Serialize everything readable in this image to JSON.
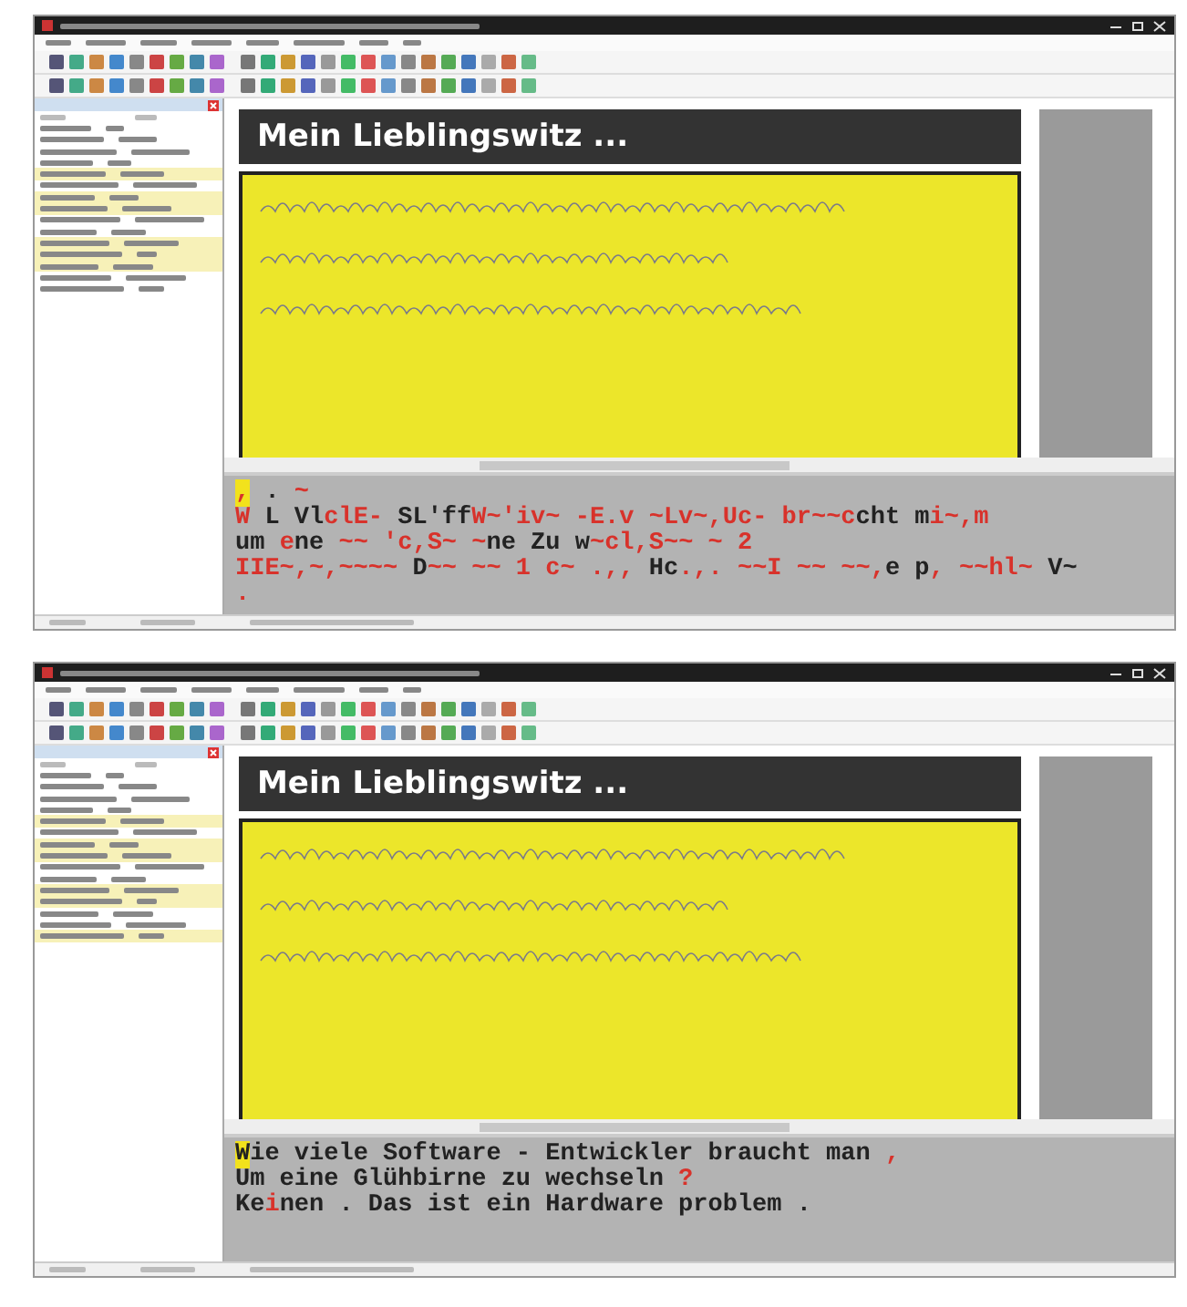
{
  "screens": [
    {
      "document_title": "Mein Lieblingswitz ...",
      "field_rows": [
        {
          "highlighted": false
        },
        {
          "highlighted": false
        },
        {
          "highlighted": false
        },
        {
          "highlighted": false
        },
        {
          "highlighted": true
        },
        {
          "highlighted": false
        },
        {
          "highlighted": true
        },
        {
          "highlighted": true
        },
        {
          "highlighted": false
        },
        {
          "highlighted": false
        },
        {
          "highlighted": true
        },
        {
          "highlighted": true
        },
        {
          "highlighted": true
        },
        {
          "highlighted": false
        },
        {
          "highlighted": false
        }
      ],
      "ocr_lines": [
        [
          {
            "text": ",",
            "uncertain": true,
            "cursor": true
          },
          {
            "text": " . ",
            "uncertain": false,
            "cursor": false
          },
          {
            "text": "~",
            "uncertain": true,
            "cursor": false
          }
        ],
        [
          {
            "text": "W",
            "uncertain": true,
            "cursor": false
          },
          {
            "text": " L Vl",
            "uncertain": false,
            "cursor": false
          },
          {
            "text": "clE-",
            "uncertain": true,
            "cursor": false
          },
          {
            "text": " SL'ff",
            "uncertain": false,
            "cursor": false
          },
          {
            "text": "W~'iv~ -E.v ~Lv~,Uc- br~~c",
            "uncertain": true,
            "cursor": false
          },
          {
            "text": "cht m",
            "uncertain": false,
            "cursor": false
          },
          {
            "text": "i~,m",
            "uncertain": true,
            "cursor": false
          }
        ],
        [
          {
            "text": "um ",
            "uncertain": false,
            "cursor": false
          },
          {
            "text": "e",
            "uncertain": true,
            "cursor": false
          },
          {
            "text": "ne",
            "uncertain": false,
            "cursor": false
          },
          {
            "text": " ~~ 'c,S~ ~",
            "uncertain": true,
            "cursor": false
          },
          {
            "text": "ne Zu w",
            "uncertain": false,
            "cursor": false
          },
          {
            "text": "~cl,S~~ ~ 2",
            "uncertain": true,
            "cursor": false
          }
        ],
        [
          {
            "text": "IIE~,~,~~~~",
            "uncertain": true,
            "cursor": false
          },
          {
            "text": " D",
            "uncertain": false,
            "cursor": false
          },
          {
            "text": "~~ ~~ 1 c~ .,,",
            "uncertain": true,
            "cursor": false
          },
          {
            "text": " Hc",
            "uncertain": false,
            "cursor": false
          },
          {
            "text": ".,. ~~I ~~ ~~,",
            "uncertain": true,
            "cursor": false
          },
          {
            "text": "e p",
            "uncertain": false,
            "cursor": false
          },
          {
            "text": ", ~~hl~",
            "uncertain": true,
            "cursor": false
          },
          {
            "text": " V~",
            "uncertain": false,
            "cursor": false
          }
        ],
        [
          {
            "text": ".",
            "uncertain": true,
            "cursor": false
          }
        ]
      ]
    },
    {
      "document_title": "Mein Lieblingswitz ...",
      "field_rows": [
        {
          "highlighted": false
        },
        {
          "highlighted": false
        },
        {
          "highlighted": false
        },
        {
          "highlighted": false
        },
        {
          "highlighted": true
        },
        {
          "highlighted": false
        },
        {
          "highlighted": true
        },
        {
          "highlighted": true
        },
        {
          "highlighted": false
        },
        {
          "highlighted": false
        },
        {
          "highlighted": true
        },
        {
          "highlighted": true
        },
        {
          "highlighted": false
        },
        {
          "highlighted": false
        },
        {
          "highlighted": true
        }
      ],
      "ocr_lines": [
        [
          {
            "text": "W",
            "uncertain": false,
            "cursor": true
          },
          {
            "text": "ie viele Software - Entwickler braucht man ",
            "uncertain": false,
            "cursor": false
          },
          {
            "text": ",",
            "uncertain": true,
            "cursor": false
          }
        ],
        [
          {
            "text": "Um eine Glühbirne zu wechseln ",
            "uncertain": false,
            "cursor": false
          },
          {
            "text": "?",
            "uncertain": true,
            "cursor": false
          }
        ],
        [
          {
            "text": "Ke",
            "uncertain": false,
            "cursor": false
          },
          {
            "text": "i",
            "uncertain": true,
            "cursor": false
          },
          {
            "text": "nen . Das ist ein Hardware problem .",
            "uncertain": false,
            "cursor": false
          }
        ]
      ]
    }
  ]
}
